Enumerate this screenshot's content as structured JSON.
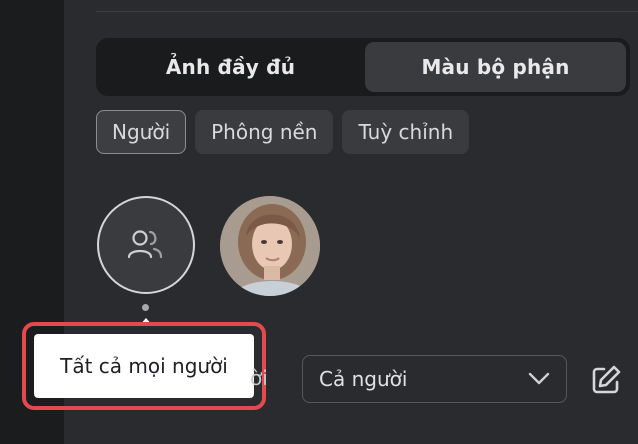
{
  "mode_toggle": {
    "options": [
      "Ảnh đầy đủ",
      "Màu bộ phận"
    ],
    "active": "Màu bộ phận"
  },
  "filter_chips": [
    {
      "label": "Người",
      "selected": true
    },
    {
      "label": "Phông nền",
      "selected": false
    },
    {
      "label": "Tuỳ chỉnh",
      "selected": false
    }
  ],
  "people": {
    "all_icon": "people-icon",
    "person_thumbnail": "woman-portrait"
  },
  "tooltip": {
    "text": "Tất cả mọi người"
  },
  "partial_label": "ời",
  "select": {
    "value": "Cả người",
    "icon": "chevron-down-icon"
  },
  "edit_icon": "edit-icon",
  "colors": {
    "panel_bg": "#2a2b2e",
    "highlight_border": "#e5484d"
  }
}
